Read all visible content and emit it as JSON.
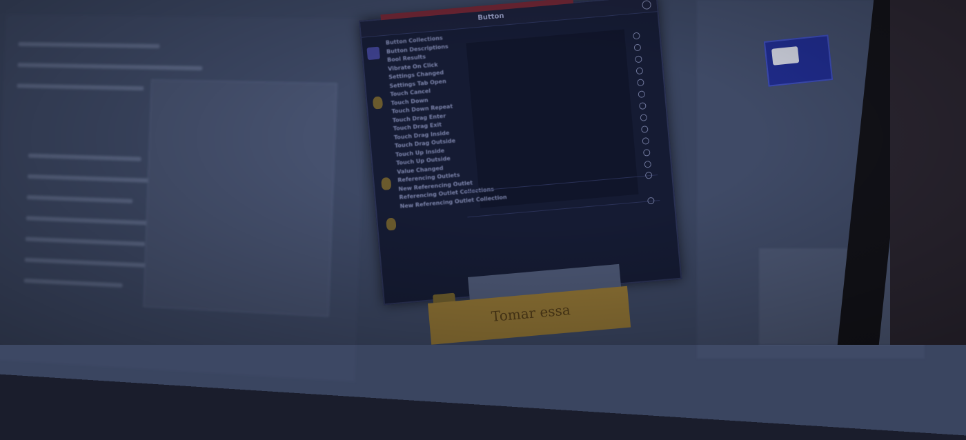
{
  "popup": {
    "title": "Button",
    "items": [
      "Button Collections",
      "Button Descriptions",
      "Bool Results",
      "Vibrate On Click",
      "Settings Changed",
      "Settings Tab Open",
      "Touch Cancel",
      "Touch Down",
      "Touch Down Repeat",
      "Touch Drag Enter",
      "Touch Drag Exit",
      "Touch Drag Inside",
      "Touch Drag Outside",
      "Touch Up Inside",
      "Touch Up Outside",
      "Value Changed",
      "Referencing Outlets",
      "New Referencing Outlet",
      "Referencing Outlet Collections",
      "New Referencing Outlet Collection"
    ]
  },
  "footer": {
    "button_label": "Tomar essa"
  },
  "colors": {
    "popup_bg": "#151b33",
    "gold": "#8c7134",
    "thumbnail_blue": "#1f2b8a"
  }
}
